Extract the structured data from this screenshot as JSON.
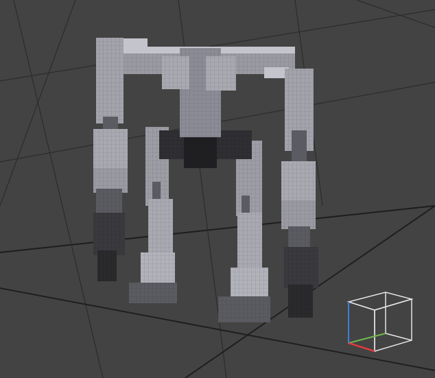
{
  "viewport": {
    "background_color": "#434343",
    "grid_color": "#2b2b2b",
    "grid_major_color": "#1f1f1f"
  },
  "model": {
    "name": "voxel-mech-walker",
    "colors": {
      "light": "#a9a9b2",
      "mid": "#8c8c96",
      "dark": "#5b5b62",
      "darker": "#3a3a3e",
      "edge": "#2a2a2d",
      "core": "#2c2c30"
    }
  },
  "orientation_gizmo": {
    "icon": "view-cube-icon",
    "x_axis_color": "#e23b3b",
    "y_axis_color": "#6fb84a",
    "z_axis_color": "#3f7fd6",
    "cube_color": "#e6e6e6"
  }
}
